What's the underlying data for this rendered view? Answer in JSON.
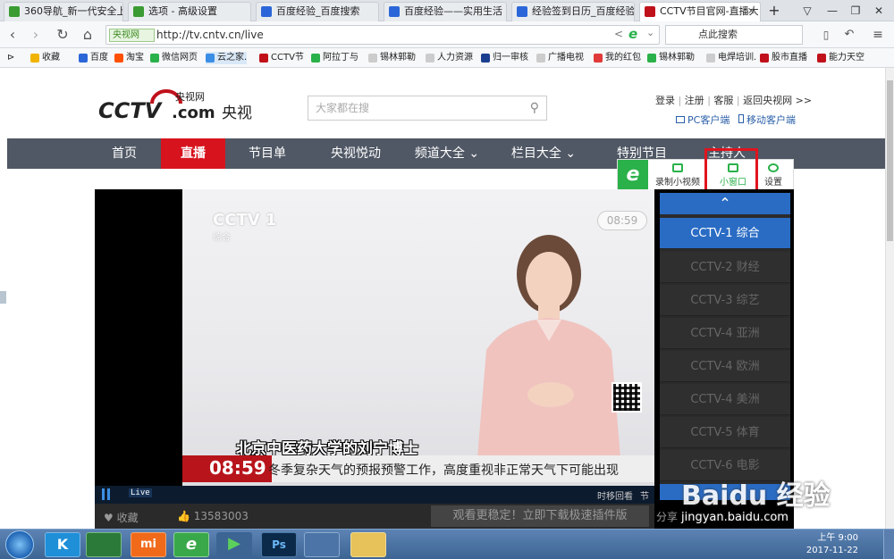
{
  "tabs": [
    {
      "label": "360导航_新一代安全上",
      "icon_color": "#3a9b32"
    },
    {
      "label": "选项 - 高级设置",
      "icon_color": "#3a9b32"
    },
    {
      "label": "百度经验_百度搜索",
      "icon_color": "#2b66d9"
    },
    {
      "label": "百度经验——实用生活",
      "icon_color": "#2b66d9"
    },
    {
      "label": "经验签到日历_百度经验",
      "icon_color": "#2b66d9"
    },
    {
      "label": "CCTV节目官网-直播大",
      "icon_color": "#c0111b"
    }
  ],
  "addressbar": {
    "site_label": "央视网",
    "url": "http://tv.cntv.cn/live",
    "search_label": "点此搜索"
  },
  "bookmarks": [
    "收藏",
    "百度",
    "淘宝",
    "微信网页",
    "云之家.",
    "CCTV节",
    "阿拉丁与",
    "锡林郭勒",
    "人力资源",
    "归一审核",
    "广播电视",
    "我的红包",
    "锡林郭勒",
    "电焊培训.",
    "股市直播",
    "能力天空"
  ],
  "header": {
    "logo_text": "CCTV",
    "logo_com": ".com",
    "logo_cn": "央视网",
    "logo_sub": "央视",
    "search_placeholder": "大家都在搜",
    "links": {
      "login": "登录",
      "register": "注册",
      "guest": "客服",
      "return": "返回央视网 >>",
      "pc_client": "PC客户端",
      "mobile_client": "移动客户端"
    }
  },
  "nav": [
    "首页",
    "直播",
    "节目单",
    "央视悦动",
    "频道大全",
    "栏目大全",
    "特别节目",
    "主持人"
  ],
  "plugin": {
    "record": "录制小视频",
    "small_window": "小窗口",
    "settings": "设置"
  },
  "video": {
    "channel_logo": "CCTV 1",
    "channel_sub": "综合",
    "time_overlay": "08:59",
    "subtitle": "北京中医药大学的刘宁博士",
    "ticker_time": "08:59",
    "ticker_text": "冬季复杂天气的预报预警工作，高度重视非正常天气下可能出现",
    "live_label": "Live",
    "timeshift": "时移回看",
    "review": "节目"
  },
  "channels": [
    "CCTV-1 综合",
    "CCTV-2 财经",
    "CCTV-3 综艺",
    "CCTV-4 亚洲",
    "CCTV-4 欧洲",
    "CCTV-4 美洲",
    "CCTV-5 体育",
    "CCTV-6 电影"
  ],
  "below_player": {
    "collect": "收藏",
    "likes": "13583003",
    "banner": "观看更稳定！立即下载极速插件版",
    "share": "分享"
  },
  "taskbar": {
    "time": "上午 9:00",
    "date": "2017-11-22"
  },
  "watermark": {
    "brand": "Baidu 经验",
    "url": "jingyan.baidu.com"
  }
}
